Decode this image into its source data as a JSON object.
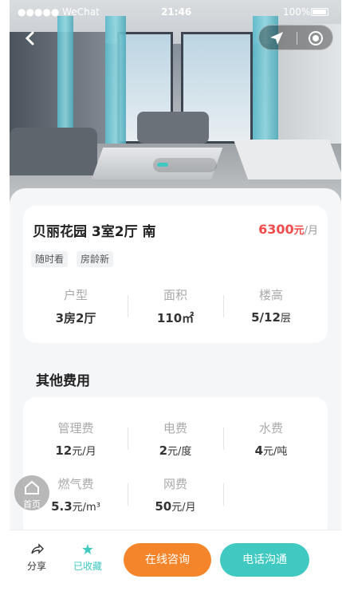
{
  "status_bar": {
    "carrier": "●●●●● WeChat",
    "time": "21:46",
    "battery": "100%"
  },
  "listing": {
    "title": "贝丽花园 3室2厅 南",
    "price": "6300",
    "price_unit": "元",
    "price_per": "/月",
    "tags": [
      "随时看",
      "房龄新"
    ],
    "stats": [
      {
        "label": "户型",
        "value": "3房2厅",
        "unit": ""
      },
      {
        "label": "面积",
        "value": "110㎡",
        "unit": ""
      },
      {
        "label": "楼高",
        "value": "5/12",
        "unit": "层"
      }
    ]
  },
  "fees": {
    "section_title": "其他费用",
    "items": [
      {
        "label": "管理费",
        "value": "12",
        "unit": "元/月"
      },
      {
        "label": "电费",
        "value": "2",
        "unit": "元/度"
      },
      {
        "label": "水费",
        "value": "4",
        "unit": "元/吨"
      },
      {
        "label": "燃气费",
        "value": "5.3",
        "unit": "元/m³"
      },
      {
        "label": "网费",
        "value": "50",
        "unit": "元/月"
      }
    ]
  },
  "home_fab": {
    "label": "首页"
  },
  "bottom_bar": {
    "share_label": "分享",
    "favorite_label": "已收藏",
    "consult_label": "在线咨询",
    "call_label": "电话沟通"
  },
  "colors": {
    "accent": "#3fc9c0",
    "price": "#f24b4b",
    "consult": "#f5852a"
  }
}
